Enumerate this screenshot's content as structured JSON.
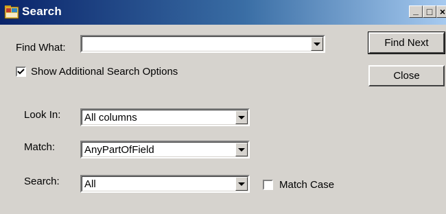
{
  "window": {
    "title": "Search",
    "minimize_glyph": "_",
    "maximize_glyph": "□",
    "close_glyph": "×"
  },
  "find_what": {
    "label": "Find What:",
    "value": ""
  },
  "buttons": {
    "find_next": "Find Next",
    "close": "Close"
  },
  "show_additional": {
    "label": "Show Additional Search Options",
    "checked": true
  },
  "look_in": {
    "label": "Look In:",
    "value": "All columns"
  },
  "match": {
    "label": "Match:",
    "value": "AnyPartOfField"
  },
  "search": {
    "label": "Search:",
    "value": "All"
  },
  "match_case": {
    "label": "Match Case",
    "checked": false
  }
}
